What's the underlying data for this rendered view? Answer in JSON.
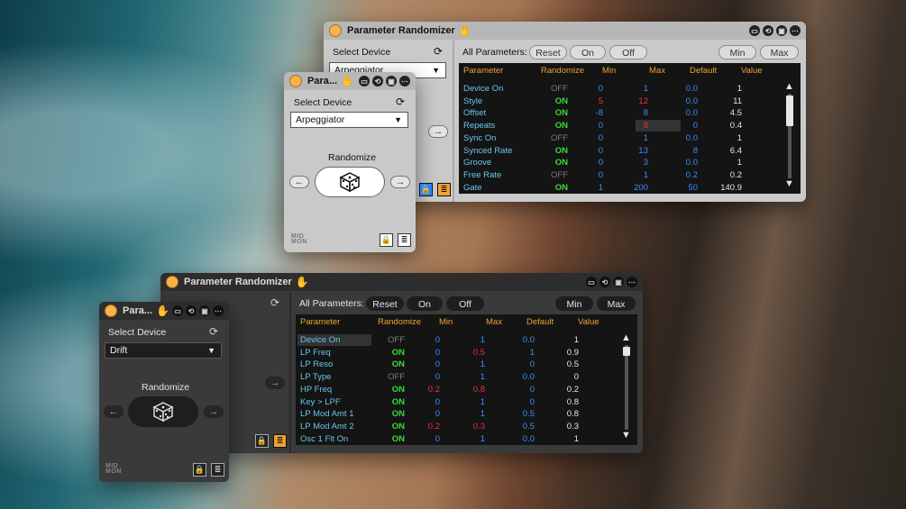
{
  "app": {
    "title": "Parameter Randomizer",
    "title_truncated": "Para...",
    "labels": {
      "select_device": "Select Device",
      "randomize": "Randomize",
      "all_parameters": "All Parameters:"
    },
    "buttons": {
      "reset": "Reset",
      "on": "On",
      "off": "Off",
      "min": "Min",
      "max": "Max"
    },
    "columns": [
      "Parameter",
      "Randomize",
      "Min",
      "Max",
      "Default",
      "Value"
    ],
    "logo": "MID\nMON"
  },
  "top": {
    "device": "Arpeggiator",
    "rows": [
      {
        "name": "Device On",
        "randomize": "OFF",
        "min": "0",
        "max": "1",
        "default": "0.0",
        "value": "1"
      },
      {
        "name": "Style",
        "randomize": "ON",
        "min": "5",
        "max": "12",
        "default": "0.0",
        "value": "11"
      },
      {
        "name": "Offset",
        "randomize": "ON",
        "min": "-8",
        "max": "8",
        "default": "0.0",
        "value": "4.5"
      },
      {
        "name": "Repeats",
        "randomize": "ON",
        "min": "0",
        "max": "8",
        "default": "0",
        "value": "0.4"
      },
      {
        "name": "Sync On",
        "randomize": "OFF",
        "min": "0",
        "max": "1",
        "default": "0.0",
        "value": "1"
      },
      {
        "name": "Synced Rate",
        "randomize": "ON",
        "min": "0",
        "max": "13",
        "default": "8",
        "value": "6.4"
      },
      {
        "name": "Groove",
        "randomize": "ON",
        "min": "0",
        "max": "3",
        "default": "0.0",
        "value": "1"
      },
      {
        "name": "Free Rate",
        "randomize": "OFF",
        "min": "0",
        "max": "1",
        "default": "0.2",
        "value": "0.2"
      },
      {
        "name": "Gate",
        "randomize": "ON",
        "min": "1",
        "max": "200",
        "default": "50",
        "value": "140.9"
      }
    ]
  },
  "bottom": {
    "device": "Drift",
    "rows": [
      {
        "name": "Device On",
        "randomize": "OFF",
        "min": "0",
        "max": "1",
        "default": "0.0",
        "value": "1"
      },
      {
        "name": "LP Freq",
        "randomize": "ON",
        "min": "0",
        "max": "0.5",
        "default": "1",
        "value": "0.9"
      },
      {
        "name": "LP Reso",
        "randomize": "ON",
        "min": "0",
        "max": "1",
        "default": "0",
        "value": "0.5"
      },
      {
        "name": "LP Type",
        "randomize": "OFF",
        "min": "0",
        "max": "1",
        "default": "0.0",
        "value": "0"
      },
      {
        "name": "HP Freq",
        "randomize": "ON",
        "min": "0.2",
        "max": "0.8",
        "default": "0",
        "value": "0.2"
      },
      {
        "name": "Key > LPF",
        "randomize": "ON",
        "min": "0",
        "max": "1",
        "default": "0",
        "value": "0.8"
      },
      {
        "name": "LP Mod Amt 1",
        "randomize": "ON",
        "min": "0",
        "max": "1",
        "default": "0.5",
        "value": "0.8"
      },
      {
        "name": "LP Mod Amt 2",
        "randomize": "ON",
        "min": "0.2",
        "max": "0.3",
        "default": "0.5",
        "value": "0.3"
      },
      {
        "name": "Osc 1 Flt On",
        "randomize": "ON",
        "min": "0",
        "max": "1",
        "default": "0.0",
        "value": "1"
      }
    ]
  },
  "colors": {
    "header": "#f0a232",
    "param_name": "#6cc4ea",
    "on": "#3adb3a",
    "off": "#7c7c7c",
    "min_max_default": "#3b8fff",
    "changed": "#f03030",
    "title_dot": "#f7b24a",
    "hand_icon": "#3b3bf5"
  }
}
